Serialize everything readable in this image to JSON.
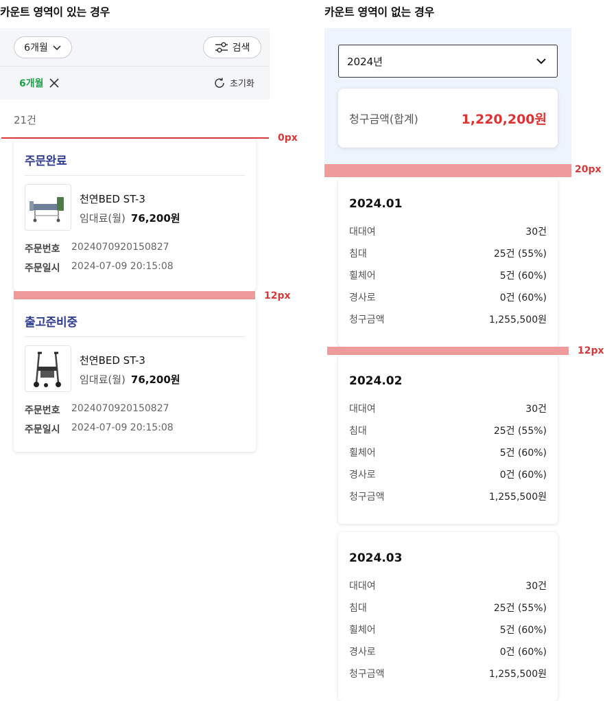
{
  "left": {
    "title": "카운트 영역이 있는 경우",
    "period_select": "6개월",
    "search_button": "검색",
    "active_chip": "6개월",
    "reset_button": "초기화",
    "count": "21건",
    "gap_top_label": "0px",
    "gap_between_label": "12px",
    "orders": [
      {
        "status": "주문완료",
        "product": "천연BED ST-3",
        "rent_label": "임대료(월)",
        "rent_value": "76,200원",
        "order_no_label": "주문번호",
        "order_no": "2024070920150827",
        "order_date_label": "주문일시",
        "order_date": "2024-07-09 20:15:08"
      },
      {
        "status": "출고준비중",
        "product": "천연BED ST-3",
        "rent_label": "임대료(월)",
        "rent_value": "76,200원",
        "order_no_label": "주문번호",
        "order_no": "2024070920150827",
        "order_date_label": "주문일시",
        "order_date": "2024-07-09 20:15:08"
      }
    ]
  },
  "right": {
    "title": "카운트 영역이 없는 경우",
    "year_select": "2024년",
    "total_label": "청구금액(합계)",
    "total_value": "1,220,200원",
    "gap_top_label": "20px",
    "gap_between_label": "12px",
    "months": [
      {
        "title": "2024.01",
        "rows": [
          {
            "k": "대대여",
            "v": "30건"
          },
          {
            "k": "침대",
            "v": "25건 (55%)"
          },
          {
            "k": "휠체어",
            "v": "5건 (60%)"
          },
          {
            "k": "경사로",
            "v": "0건 (60%)"
          },
          {
            "k": "청구금액",
            "v": "1,255,500원"
          }
        ]
      },
      {
        "title": "2024.02",
        "rows": [
          {
            "k": "대대여",
            "v": "30건"
          },
          {
            "k": "침대",
            "v": "25건 (55%)"
          },
          {
            "k": "휠체어",
            "v": "5건 (60%)"
          },
          {
            "k": "경사로",
            "v": "0건 (60%)"
          },
          {
            "k": "청구금액",
            "v": "1,255,500원"
          }
        ]
      },
      {
        "title": "2024.03",
        "rows": [
          {
            "k": "대대여",
            "v": "30건"
          },
          {
            "k": "침대",
            "v": "25건 (55%)"
          },
          {
            "k": "휠체어",
            "v": "5건 (60%)"
          },
          {
            "k": "경사로",
            "v": "0건 (60%)"
          },
          {
            "k": "청구금액",
            "v": "1,255,500원"
          }
        ]
      }
    ]
  },
  "colors": {
    "status_text": "#2f3c8f",
    "chip_green": "#1fa34a",
    "price_red": "#e03131",
    "annotation_red": "#d93838",
    "annotation_bar": "#ef9b9b",
    "blue_area": "#eef4fd"
  }
}
